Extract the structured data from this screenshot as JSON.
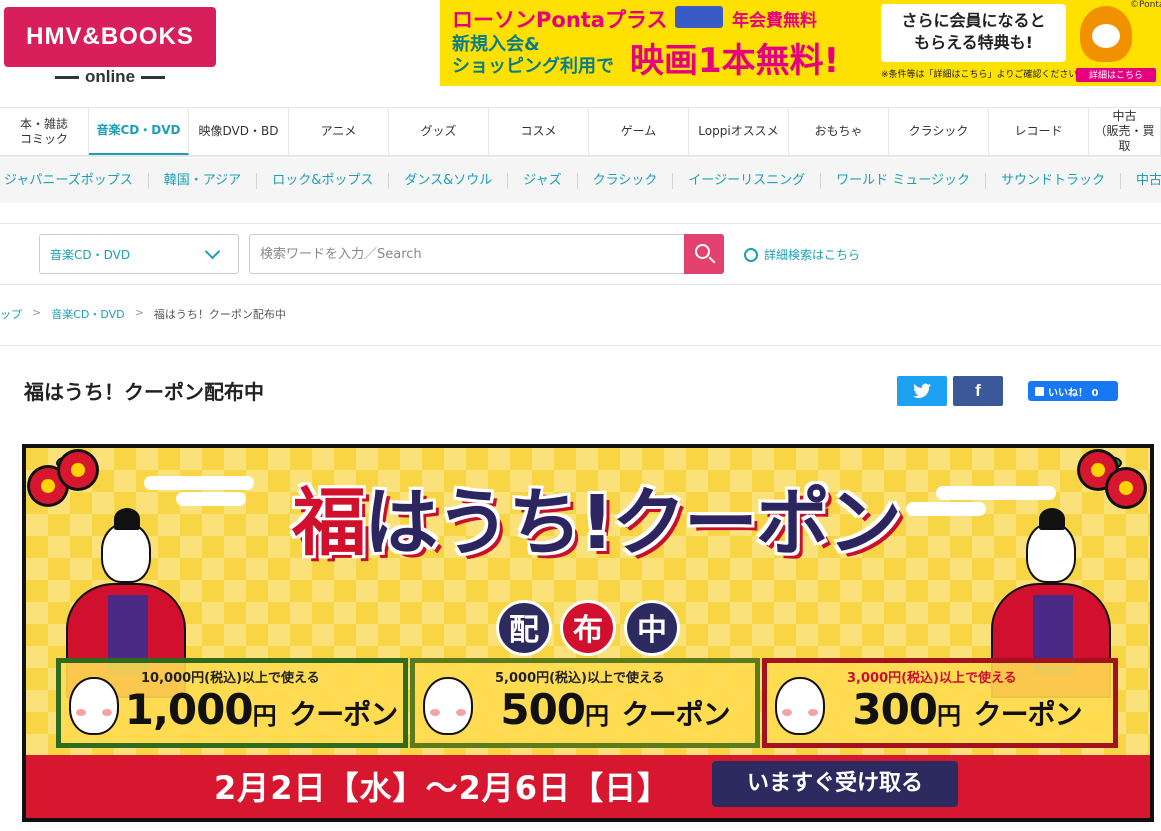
{
  "header": {
    "logo_text": "HMV&BOOKS",
    "logo_sub": "online"
  },
  "ad": {
    "line1": "ローソンPontaプラス",
    "fee": "年会費無料",
    "line2a": "新規入会&",
    "line2b": "ショッピング利用で",
    "big": "映画1本無料!",
    "box_line1": "さらに会員になると",
    "box_line2": "もらえる特典も!",
    "note": "※条件等は「詳細はこちら」よりご確認ください。",
    "detail": "詳細はこちら",
    "copyright": "©Ponta"
  },
  "main_nav": [
    {
      "label": "本・雑誌\nコミック",
      "active": false
    },
    {
      "label": "音楽CD・DVD",
      "active": true
    },
    {
      "label": "映像DVD・BD",
      "active": false
    },
    {
      "label": "アニメ",
      "active": false
    },
    {
      "label": "グッズ",
      "active": false
    },
    {
      "label": "コスメ",
      "active": false
    },
    {
      "label": "ゲーム",
      "active": false
    },
    {
      "label": "Loppiオススメ",
      "active": false
    },
    {
      "label": "おもちゃ",
      "active": false
    },
    {
      "label": "クラシック",
      "active": false
    },
    {
      "label": "レコード",
      "active": false
    },
    {
      "label": "中古\n（販売・買取",
      "active": false
    }
  ],
  "sub_nav": [
    "ジャパニーズポップス",
    "韓国・アジア",
    "ロック&ポップス",
    "ダンス&ソウル",
    "ジャズ",
    "クラシック",
    "イージーリスニング",
    "ワールド ミュージック",
    "サウンドトラック",
    "中古"
  ],
  "search": {
    "category": "音楽CD・DVD",
    "placeholder": "検索ワードを入力／Search",
    "advanced": "詳細検索はこちら"
  },
  "breadcrumb": {
    "items": [
      "ップ",
      "音楽CD・DVD"
    ],
    "current": "福はうち！クーポン配布中"
  },
  "page": {
    "title": "福はうち！クーポン配布中"
  },
  "social": {
    "facebook": "f",
    "like": "いいね！ 0"
  },
  "banner": {
    "title_first": "福",
    "title_rest": "はうち!クーポン",
    "badges": [
      "配",
      "布",
      "中"
    ],
    "coupons": [
      {
        "condition": "10,000円(税込)以上で使える",
        "amount": "1,000",
        "unit": "円",
        "label": "クーポン",
        "border": "#2f6b1f"
      },
      {
        "condition": "5,000円(税込)以上で使える",
        "amount": "500",
        "unit": "円",
        "label": "クーポン",
        "border": "#5d7a1e"
      },
      {
        "condition": "3,000円(税込)以上で使える",
        "amount": "300",
        "unit": "円",
        "label": "クーポン",
        "border": "#a3121f"
      }
    ],
    "date": "2月2日【水】〜2月6日【日】",
    "button": "いますぐ受け取る"
  }
}
